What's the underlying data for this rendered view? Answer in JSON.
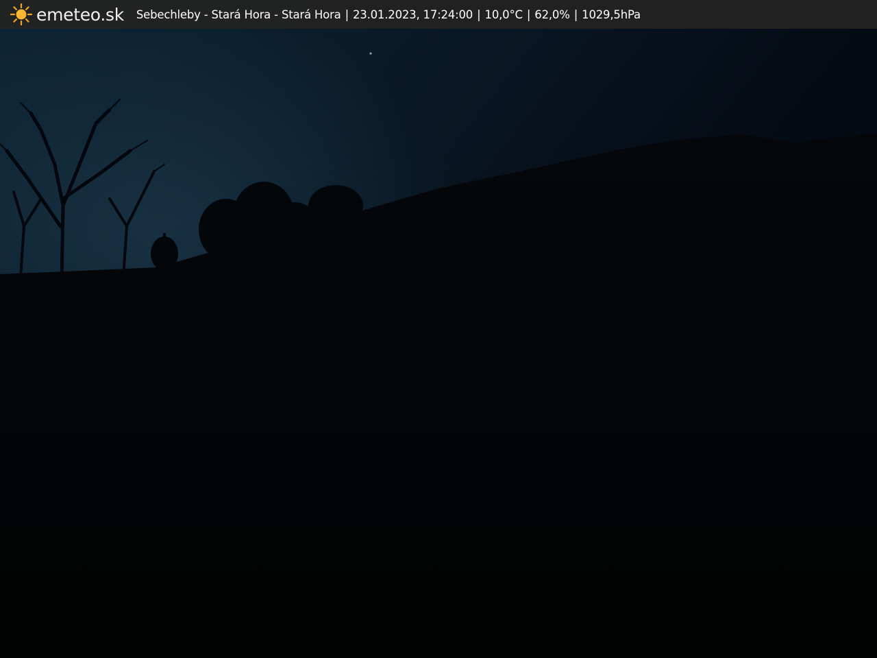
{
  "brand": {
    "logo_icon": "sun-icon",
    "name": "emeteo.sk",
    "accent_color": "#f5a623"
  },
  "station": {
    "location": "Sebechleby - Stará Hora - Stará Hora",
    "datetime": "23.01.2023, 17:24:00",
    "temperature": "10,0°C",
    "humidity": "62,0%",
    "pressure": "1029,5hPa",
    "separator": "|"
  }
}
